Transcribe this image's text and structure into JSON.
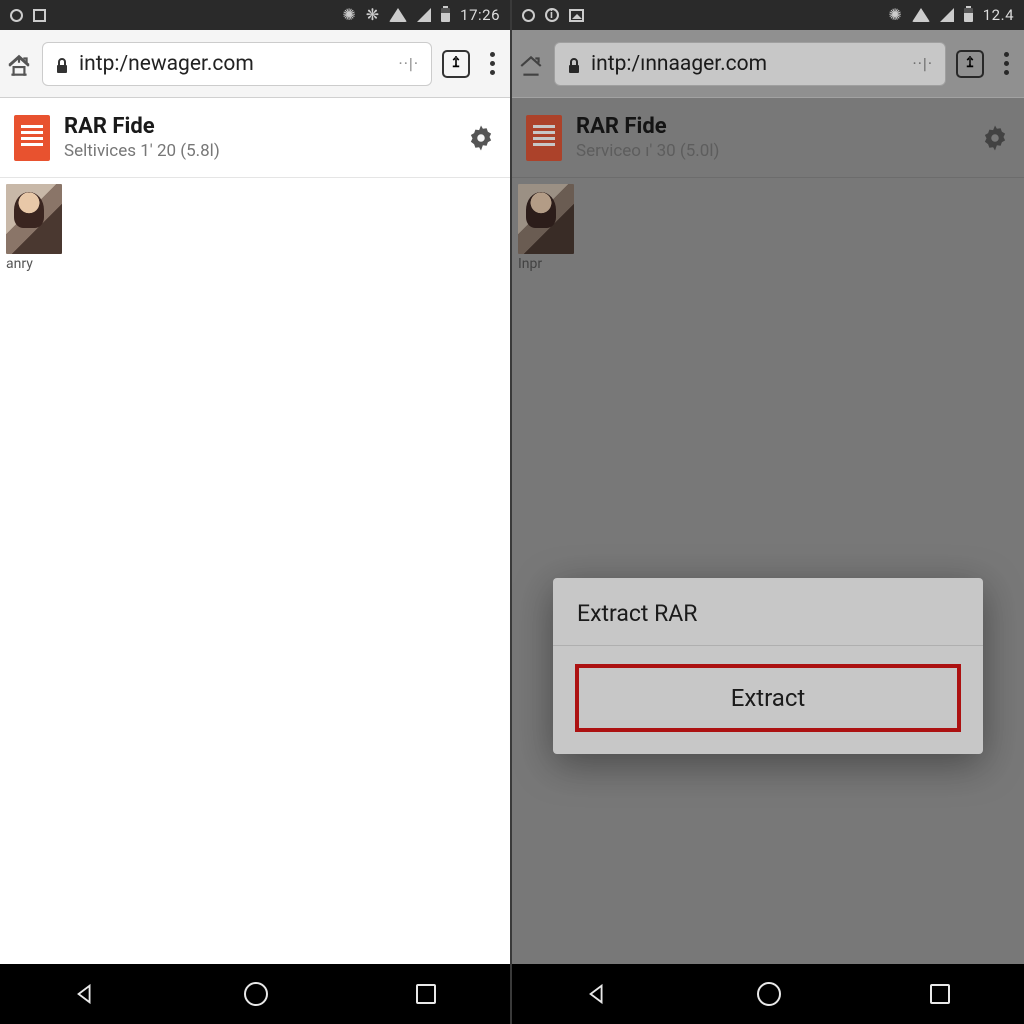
{
  "left": {
    "status": {
      "time": "17:26"
    },
    "toolbar": {
      "url": "intp:/newager.com",
      "url_tail": "··|·"
    },
    "file": {
      "title": "RAR Fide",
      "subtitle": "Seltivices 1' 20 (5.8l)"
    },
    "thumb": {
      "label": "anry"
    }
  },
  "right": {
    "status": {
      "time": "12.4"
    },
    "toolbar": {
      "url": "intp:/ınnaager.com",
      "url_tail": "··|·"
    },
    "file": {
      "title": "RAR Fide",
      "subtitle": "Serviceo ı' 30 (5.0l)"
    },
    "thumb": {
      "label": "Inpr"
    },
    "dialog": {
      "title": "Extract RAR",
      "button": "Extract"
    }
  }
}
